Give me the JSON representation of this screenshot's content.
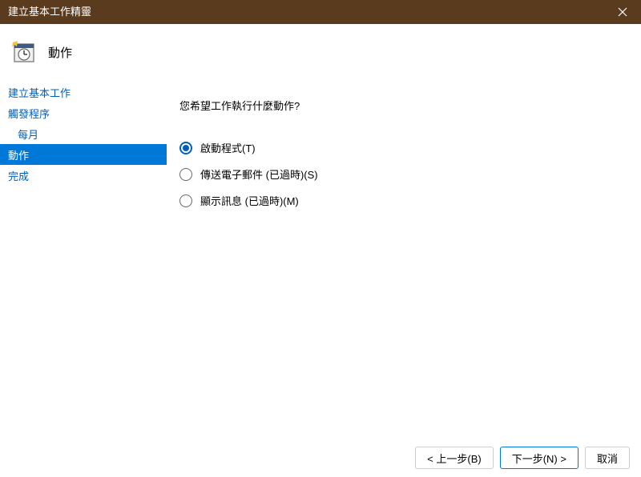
{
  "window": {
    "title": "建立基本工作精靈"
  },
  "header": {
    "title": "動作"
  },
  "sidebar": {
    "items": [
      {
        "label": "建立基本工作",
        "indent": false,
        "active": false
      },
      {
        "label": "觸發程序",
        "indent": false,
        "active": false
      },
      {
        "label": "每月",
        "indent": true,
        "active": false
      },
      {
        "label": "動作",
        "indent": false,
        "active": true
      },
      {
        "label": "完成",
        "indent": false,
        "active": false
      }
    ]
  },
  "main": {
    "question": "您希望工作執行什麼動作?",
    "options": [
      {
        "label": "啟動程式(T)",
        "checked": true
      },
      {
        "label": "傳送電子郵件 (已過時)(S)",
        "checked": false
      },
      {
        "label": "顯示訊息 (已過時)(M)",
        "checked": false
      }
    ]
  },
  "footer": {
    "back": "< 上一步(B)",
    "next": "下一步(N) >",
    "cancel": "取消"
  }
}
